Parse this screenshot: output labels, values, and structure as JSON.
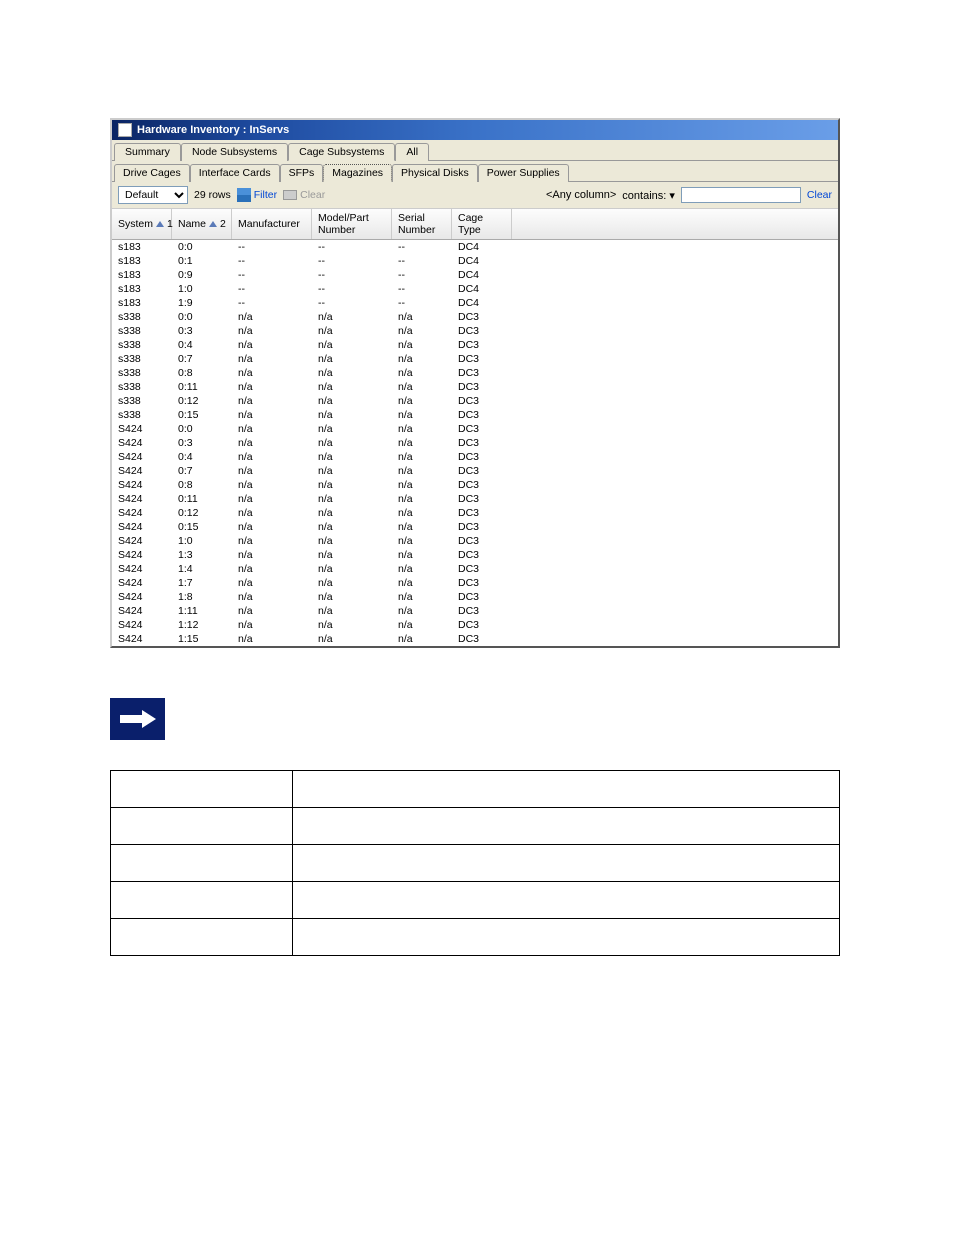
{
  "titlebar": {
    "title": "Hardware Inventory : InServs"
  },
  "tabs": {
    "main": [
      "Summary",
      "Node Subsystems",
      "Cage Subsystems",
      "All"
    ],
    "main_active": 2,
    "sub": [
      "Drive Cages",
      "Interface Cards",
      "SFPs",
      "Magazines",
      "Physical Disks",
      "Power Supplies"
    ],
    "sub_active": 3
  },
  "toolbar": {
    "view_label": "Default",
    "row_count": "29 rows",
    "filter_label": "Filter",
    "clear_label": "Clear",
    "filter_col": "<Any column>",
    "filter_op": "contains:",
    "clear_link": "Clear"
  },
  "columns": [
    {
      "label": "System",
      "sort": 1,
      "cls": "c-system"
    },
    {
      "label": "Name",
      "sort": 2,
      "cls": "c-name"
    },
    {
      "label": "Manufacturer",
      "cls": "c-mfr"
    },
    {
      "label": "Model/Part Number",
      "cls": "c-model"
    },
    {
      "label": "Serial Number",
      "cls": "c-serial"
    },
    {
      "label": "Cage Type",
      "cls": "c-cage"
    }
  ],
  "rows": [
    {
      "system": "s183",
      "name": "0:0",
      "mfr": "--",
      "model": "--",
      "serial": "--",
      "cage": "DC4"
    },
    {
      "system": "s183",
      "name": "0:1",
      "mfr": "--",
      "model": "--",
      "serial": "--",
      "cage": "DC4"
    },
    {
      "system": "s183",
      "name": "0:9",
      "mfr": "--",
      "model": "--",
      "serial": "--",
      "cage": "DC4"
    },
    {
      "system": "s183",
      "name": "1:0",
      "mfr": "--",
      "model": "--",
      "serial": "--",
      "cage": "DC4"
    },
    {
      "system": "s183",
      "name": "1:9",
      "mfr": "--",
      "model": "--",
      "serial": "--",
      "cage": "DC4"
    },
    {
      "system": "s338",
      "name": "0:0",
      "mfr": "n/a",
      "model": "n/a",
      "serial": "n/a",
      "cage": "DC3"
    },
    {
      "system": "s338",
      "name": "0:3",
      "mfr": "n/a",
      "model": "n/a",
      "serial": "n/a",
      "cage": "DC3"
    },
    {
      "system": "s338",
      "name": "0:4",
      "mfr": "n/a",
      "model": "n/a",
      "serial": "n/a",
      "cage": "DC3"
    },
    {
      "system": "s338",
      "name": "0:7",
      "mfr": "n/a",
      "model": "n/a",
      "serial": "n/a",
      "cage": "DC3"
    },
    {
      "system": "s338",
      "name": "0:8",
      "mfr": "n/a",
      "model": "n/a",
      "serial": "n/a",
      "cage": "DC3"
    },
    {
      "system": "s338",
      "name": "0:11",
      "mfr": "n/a",
      "model": "n/a",
      "serial": "n/a",
      "cage": "DC3"
    },
    {
      "system": "s338",
      "name": "0:12",
      "mfr": "n/a",
      "model": "n/a",
      "serial": "n/a",
      "cage": "DC3"
    },
    {
      "system": "s338",
      "name": "0:15",
      "mfr": "n/a",
      "model": "n/a",
      "serial": "n/a",
      "cage": "DC3"
    },
    {
      "system": "S424",
      "name": "0:0",
      "mfr": "n/a",
      "model": "n/a",
      "serial": "n/a",
      "cage": "DC3"
    },
    {
      "system": "S424",
      "name": "0:3",
      "mfr": "n/a",
      "model": "n/a",
      "serial": "n/a",
      "cage": "DC3"
    },
    {
      "system": "S424",
      "name": "0:4",
      "mfr": "n/a",
      "model": "n/a",
      "serial": "n/a",
      "cage": "DC3"
    },
    {
      "system": "S424",
      "name": "0:7",
      "mfr": "n/a",
      "model": "n/a",
      "serial": "n/a",
      "cage": "DC3"
    },
    {
      "system": "S424",
      "name": "0:8",
      "mfr": "n/a",
      "model": "n/a",
      "serial": "n/a",
      "cage": "DC3"
    },
    {
      "system": "S424",
      "name": "0:11",
      "mfr": "n/a",
      "model": "n/a",
      "serial": "n/a",
      "cage": "DC3"
    },
    {
      "system": "S424",
      "name": "0:12",
      "mfr": "n/a",
      "model": "n/a",
      "serial": "n/a",
      "cage": "DC3"
    },
    {
      "system": "S424",
      "name": "0:15",
      "mfr": "n/a",
      "model": "n/a",
      "serial": "n/a",
      "cage": "DC3"
    },
    {
      "system": "S424",
      "name": "1:0",
      "mfr": "n/a",
      "model": "n/a",
      "serial": "n/a",
      "cage": "DC3"
    },
    {
      "system": "S424",
      "name": "1:3",
      "mfr": "n/a",
      "model": "n/a",
      "serial": "n/a",
      "cage": "DC3"
    },
    {
      "system": "S424",
      "name": "1:4",
      "mfr": "n/a",
      "model": "n/a",
      "serial": "n/a",
      "cage": "DC3"
    },
    {
      "system": "S424",
      "name": "1:7",
      "mfr": "n/a",
      "model": "n/a",
      "serial": "n/a",
      "cage": "DC3"
    },
    {
      "system": "S424",
      "name": "1:8",
      "mfr": "n/a",
      "model": "n/a",
      "serial": "n/a",
      "cage": "DC3"
    },
    {
      "system": "S424",
      "name": "1:11",
      "mfr": "n/a",
      "model": "n/a",
      "serial": "n/a",
      "cage": "DC3"
    },
    {
      "system": "S424",
      "name": "1:12",
      "mfr": "n/a",
      "model": "n/a",
      "serial": "n/a",
      "cage": "DC3"
    },
    {
      "system": "S424",
      "name": "1:15",
      "mfr": "n/a",
      "model": "n/a",
      "serial": "n/a",
      "cage": "DC3"
    }
  ],
  "desc_table": {
    "rows": [
      {
        "col": "",
        "desc": ""
      },
      {
        "col": "",
        "desc": ""
      },
      {
        "col": "",
        "desc": ""
      },
      {
        "col": "",
        "desc": ""
      },
      {
        "col": "",
        "desc": ""
      }
    ]
  }
}
